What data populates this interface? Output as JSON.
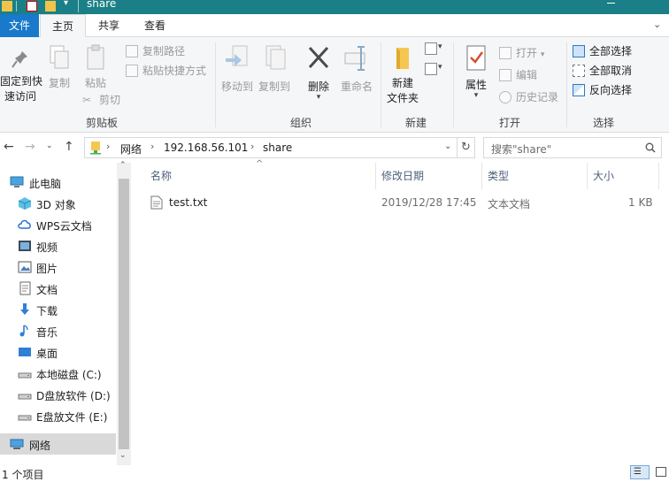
{
  "window": {
    "title": "share"
  },
  "tabs": {
    "file": "文件",
    "home": "主页",
    "share": "共享",
    "view": "查看"
  },
  "ribbon": {
    "clipboard": {
      "pin_label": "固定到快\n速访问",
      "copy_label": "复制",
      "paste_label": "粘贴",
      "copy_path_label": "复制路径",
      "paste_shortcut_label": "粘贴快捷方式",
      "cut_label": "剪切",
      "group_label": "剪贴板"
    },
    "organize": {
      "move_to_label": "移动到",
      "copy_to_label": "复制到",
      "delete_label": "删除",
      "rename_label": "重命名",
      "group_label": "组织"
    },
    "new": {
      "new_folder_label": "新建\n文件夹",
      "group_label": "新建"
    },
    "open": {
      "properties_label": "属性",
      "open_label": "打开",
      "edit_label": "编辑",
      "history_label": "历史记录",
      "group_label": "打开"
    },
    "select": {
      "select_all_label": "全部选择",
      "select_none_label": "全部取消",
      "invert_label": "反向选择",
      "group_label": "选择"
    }
  },
  "address": {
    "segments": [
      "网络",
      "192.168.56.101",
      "share"
    ],
    "search_placeholder": "搜索\"share\""
  },
  "nav": {
    "items": [
      {
        "label": "此电脑",
        "icon": "computer-icon"
      },
      {
        "label": "3D 对象",
        "icon": "3d-objects-icon"
      },
      {
        "label": "WPS云文档",
        "icon": "cloud-icon"
      },
      {
        "label": "视频",
        "icon": "video-icon"
      },
      {
        "label": "图片",
        "icon": "pictures-icon"
      },
      {
        "label": "文档",
        "icon": "documents-icon"
      },
      {
        "label": "下载",
        "icon": "download-icon"
      },
      {
        "label": "音乐",
        "icon": "music-icon"
      },
      {
        "label": "桌面",
        "icon": "desktop-icon"
      },
      {
        "label": "本地磁盘 (C:)",
        "icon": "drive-icon"
      },
      {
        "label": "D盘放软件 (D:)",
        "icon": "drive-icon"
      },
      {
        "label": "E盘放文件 (E:)",
        "icon": "drive-icon"
      },
      {
        "label": "网络",
        "icon": "network-icon"
      }
    ]
  },
  "files": {
    "columns": {
      "name": "名称",
      "modified": "修改日期",
      "type": "类型",
      "size": "大小"
    },
    "rows": [
      {
        "name": "test.txt",
        "modified": "2019/12/28 17:45",
        "type": "文本文档",
        "size": "1 KB"
      }
    ]
  },
  "status": {
    "count": "1 个项目"
  },
  "colors": {
    "titlebar": "#1a7f86",
    "file_tab": "#1979ca",
    "selection": "#d9d9d9"
  }
}
